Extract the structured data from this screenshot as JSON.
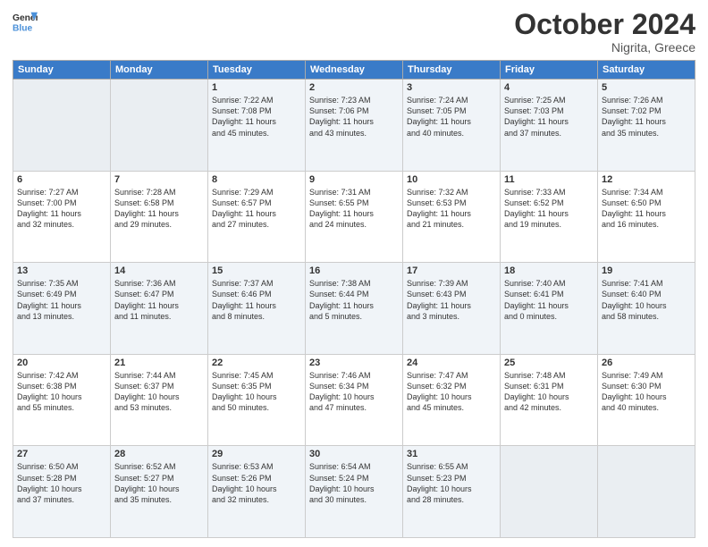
{
  "logo": {
    "line1": "General",
    "line2": "Blue"
  },
  "title": "October 2024",
  "subtitle": "Nigrita, Greece",
  "days": [
    "Sunday",
    "Monday",
    "Tuesday",
    "Wednesday",
    "Thursday",
    "Friday",
    "Saturday"
  ],
  "weeks": [
    [
      {
        "num": "",
        "empty": true
      },
      {
        "num": "",
        "empty": true
      },
      {
        "num": "1",
        "rise": "7:22 AM",
        "set": "7:08 PM",
        "dh": "11 hours",
        "dm": "45 minutes."
      },
      {
        "num": "2",
        "rise": "7:23 AM",
        "set": "7:06 PM",
        "dh": "11 hours",
        "dm": "43 minutes."
      },
      {
        "num": "3",
        "rise": "7:24 AM",
        "set": "7:05 PM",
        "dh": "11 hours",
        "dm": "40 minutes."
      },
      {
        "num": "4",
        "rise": "7:25 AM",
        "set": "7:03 PM",
        "dh": "11 hours",
        "dm": "37 minutes."
      },
      {
        "num": "5",
        "rise": "7:26 AM",
        "set": "7:02 PM",
        "dh": "11 hours",
        "dm": "35 minutes."
      }
    ],
    [
      {
        "num": "6",
        "rise": "7:27 AM",
        "set": "7:00 PM",
        "dh": "11 hours",
        "dm": "32 minutes."
      },
      {
        "num": "7",
        "rise": "7:28 AM",
        "set": "6:58 PM",
        "dh": "11 hours",
        "dm": "29 minutes."
      },
      {
        "num": "8",
        "rise": "7:29 AM",
        "set": "6:57 PM",
        "dh": "11 hours",
        "dm": "27 minutes."
      },
      {
        "num": "9",
        "rise": "7:31 AM",
        "set": "6:55 PM",
        "dh": "11 hours",
        "dm": "24 minutes."
      },
      {
        "num": "10",
        "rise": "7:32 AM",
        "set": "6:53 PM",
        "dh": "11 hours",
        "dm": "21 minutes."
      },
      {
        "num": "11",
        "rise": "7:33 AM",
        "set": "6:52 PM",
        "dh": "11 hours",
        "dm": "19 minutes."
      },
      {
        "num": "12",
        "rise": "7:34 AM",
        "set": "6:50 PM",
        "dh": "11 hours",
        "dm": "16 minutes."
      }
    ],
    [
      {
        "num": "13",
        "rise": "7:35 AM",
        "set": "6:49 PM",
        "dh": "11 hours",
        "dm": "13 minutes."
      },
      {
        "num": "14",
        "rise": "7:36 AM",
        "set": "6:47 PM",
        "dh": "11 hours",
        "dm": "11 minutes."
      },
      {
        "num": "15",
        "rise": "7:37 AM",
        "set": "6:46 PM",
        "dh": "11 hours",
        "dm": "8 minutes."
      },
      {
        "num": "16",
        "rise": "7:38 AM",
        "set": "6:44 PM",
        "dh": "11 hours",
        "dm": "5 minutes."
      },
      {
        "num": "17",
        "rise": "7:39 AM",
        "set": "6:43 PM",
        "dh": "11 hours",
        "dm": "3 minutes."
      },
      {
        "num": "18",
        "rise": "7:40 AM",
        "set": "6:41 PM",
        "dh": "11 hours",
        "dm": "0 minutes."
      },
      {
        "num": "19",
        "rise": "7:41 AM",
        "set": "6:40 PM",
        "dh": "10 hours",
        "dm": "58 minutes."
      }
    ],
    [
      {
        "num": "20",
        "rise": "7:42 AM",
        "set": "6:38 PM",
        "dh": "10 hours",
        "dm": "55 minutes."
      },
      {
        "num": "21",
        "rise": "7:44 AM",
        "set": "6:37 PM",
        "dh": "10 hours",
        "dm": "53 minutes."
      },
      {
        "num": "22",
        "rise": "7:45 AM",
        "set": "6:35 PM",
        "dh": "10 hours",
        "dm": "50 minutes."
      },
      {
        "num": "23",
        "rise": "7:46 AM",
        "set": "6:34 PM",
        "dh": "10 hours",
        "dm": "47 minutes."
      },
      {
        "num": "24",
        "rise": "7:47 AM",
        "set": "6:32 PM",
        "dh": "10 hours",
        "dm": "45 minutes."
      },
      {
        "num": "25",
        "rise": "7:48 AM",
        "set": "6:31 PM",
        "dh": "10 hours",
        "dm": "42 minutes."
      },
      {
        "num": "26",
        "rise": "7:49 AM",
        "set": "6:30 PM",
        "dh": "10 hours",
        "dm": "40 minutes."
      }
    ],
    [
      {
        "num": "27",
        "rise": "6:50 AM",
        "set": "5:28 PM",
        "dh": "10 hours",
        "dm": "37 minutes."
      },
      {
        "num": "28",
        "rise": "6:52 AM",
        "set": "5:27 PM",
        "dh": "10 hours",
        "dm": "35 minutes."
      },
      {
        "num": "29",
        "rise": "6:53 AM",
        "set": "5:26 PM",
        "dh": "10 hours",
        "dm": "32 minutes."
      },
      {
        "num": "30",
        "rise": "6:54 AM",
        "set": "5:24 PM",
        "dh": "10 hours",
        "dm": "30 minutes."
      },
      {
        "num": "31",
        "rise": "6:55 AM",
        "set": "5:23 PM",
        "dh": "10 hours",
        "dm": "28 minutes."
      },
      {
        "num": "",
        "empty": true
      },
      {
        "num": "",
        "empty": true
      }
    ]
  ]
}
